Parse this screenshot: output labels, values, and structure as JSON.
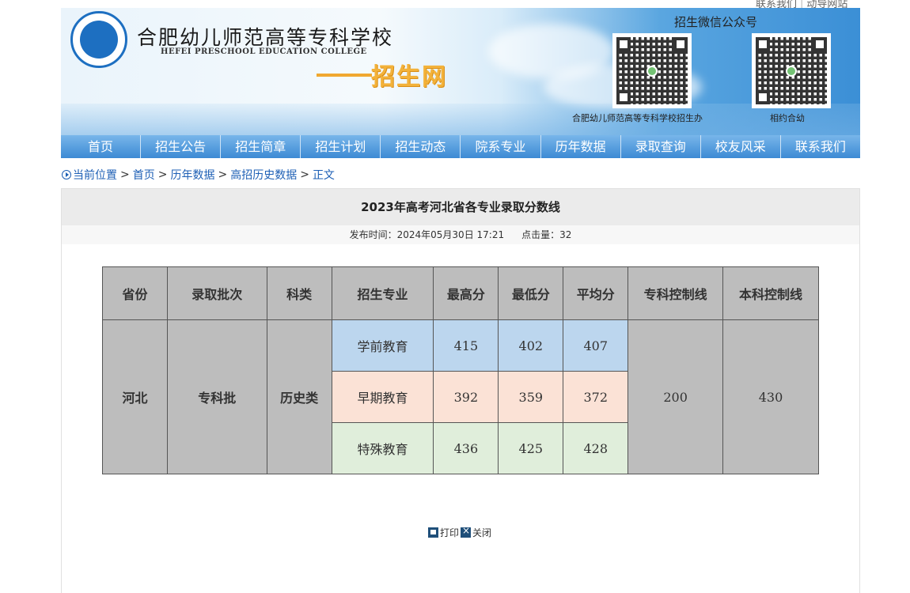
{
  "top_links": {
    "contact": "联系我们",
    "guide": "动导网站"
  },
  "header": {
    "school_name_cn": "合肥幼儿师范高等专科学校",
    "school_name_en": "HEFEI PRESCHOOL EDUCATION COLLEGE",
    "site_name": "招生网",
    "wechat_title": "招生微信公众号",
    "qr_labels": [
      "合肥幼儿师范高等专科学校招生办",
      "相约合幼"
    ]
  },
  "nav": {
    "items": [
      "首页",
      "招生公告",
      "招生简章",
      "招生计划",
      "招生动态",
      "院系专业",
      "历年数据",
      "录取查询",
      "校友风采",
      "联系我们"
    ]
  },
  "breadcrumb": {
    "prefix": "当前位置",
    "items": [
      "首页",
      "历年数据",
      "高招历史数据",
      "正文"
    ]
  },
  "article": {
    "title": "2023年高考河北省各专业录取分数线",
    "publish_label": "发布时间：",
    "publish_time": "2024年05月30日 17:21",
    "clicks_label": "点击量：",
    "clicks": "32"
  },
  "table": {
    "headers": [
      "省份",
      "录取批次",
      "科类",
      "招生专业",
      "最高分",
      "最低分",
      "平均分",
      "专科控制线",
      "本科控制线"
    ],
    "province": "河北",
    "batch": "专科批",
    "category": "历史类",
    "rows": [
      {
        "major": "学前教育",
        "max": "415",
        "min": "402",
        "avg": "407"
      },
      {
        "major": "早期教育",
        "max": "392",
        "min": "359",
        "avg": "372"
      },
      {
        "major": "特殊教育",
        "max": "436",
        "min": "425",
        "avg": "428"
      }
    ],
    "zhuanke_line": "200",
    "benke_line": "430"
  },
  "actions": {
    "print": "打印",
    "close": "关闭"
  }
}
